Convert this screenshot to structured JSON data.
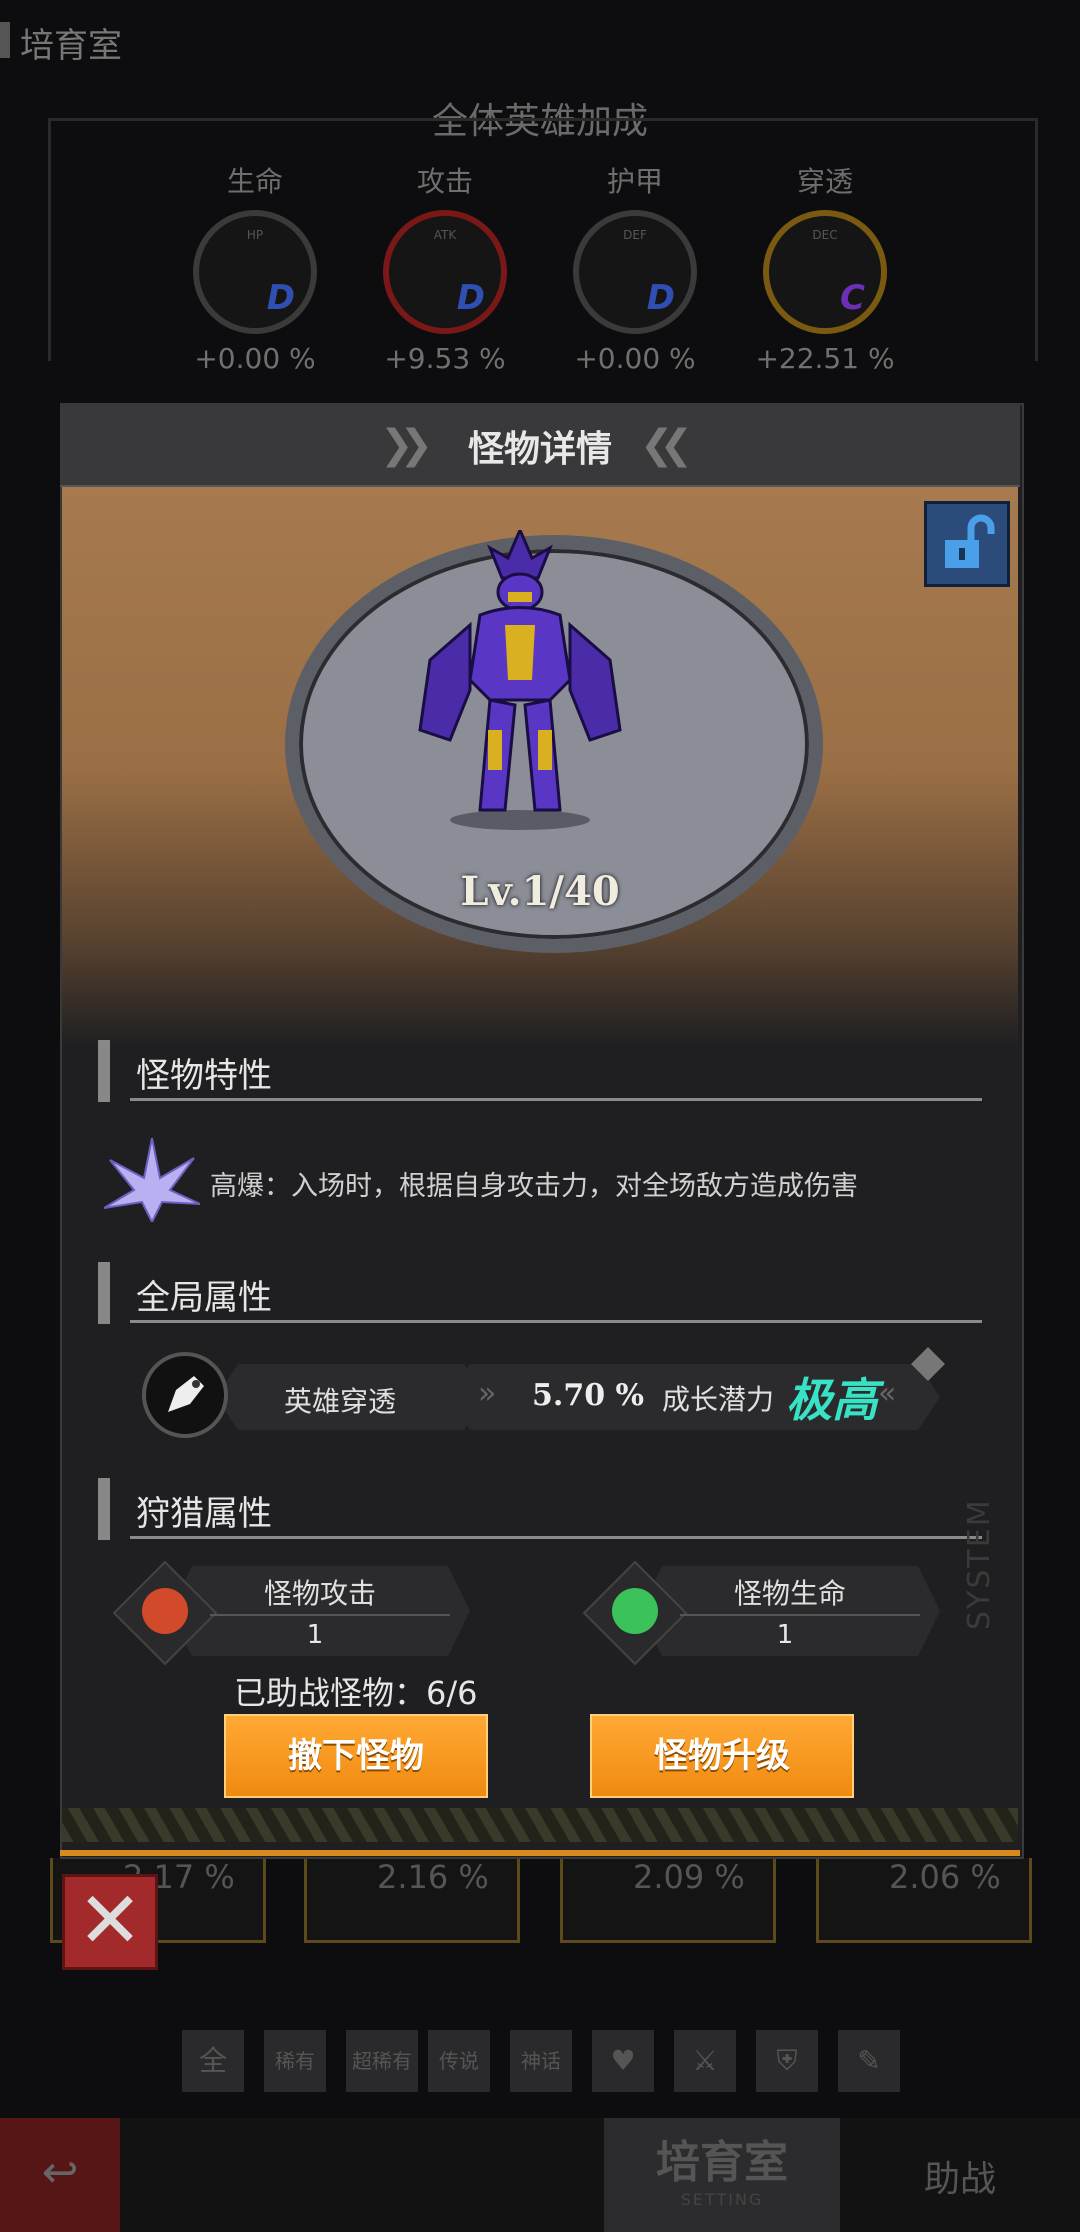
{
  "page": {
    "title": "培育室"
  },
  "bonus": {
    "title": "全体英雄加成",
    "stats": [
      {
        "label": "生命",
        "abbr": "HP",
        "grade": "D",
        "value": "+0.00 %",
        "color": "#2a2a2a",
        "grade_color": "#2f4fb5"
      },
      {
        "label": "攻击",
        "abbr": "ATK",
        "grade": "D",
        "value": "+9.53 %",
        "color": "#8a1a1a",
        "grade_color": "#2f4fb5"
      },
      {
        "label": "护甲",
        "abbr": "DEF",
        "grade": "D",
        "value": "+0.00 %",
        "color": "#2a2a2a",
        "grade_color": "#2f4fb5"
      },
      {
        "label": "穿透",
        "abbr": "DEC",
        "grade": "C",
        "value": "+22.51 %",
        "color": "#8a6a10",
        "grade_color": "#6a2fb5"
      }
    ]
  },
  "modal": {
    "title": "怪物详情",
    "level": "Lv.1/40",
    "sections": {
      "trait": "怪物特性",
      "global": "全局属性",
      "hunt": "狩猎属性"
    },
    "trait_text": "高爆：入场时，根据自身攻击力，对全场敌方造成伤害",
    "global": {
      "label": "英雄穿透",
      "value": "5.70 %",
      "growth_label": "成长潜力",
      "growth_value": "极高"
    },
    "hunt": {
      "attack_label": "怪物攻击",
      "attack_value": "1",
      "hp_label": "怪物生命",
      "hp_value": "1"
    },
    "assist_text": "已助战怪物：6/6",
    "remove_btn": "撤下怪物",
    "upgrade_btn": "怪物升级",
    "watermark": "SYSTEM"
  },
  "cards": [
    "2.17 %",
    "2.16 %",
    "2.09 %",
    "2.06 %"
  ],
  "filters": [
    "全",
    "稀有",
    "超稀有",
    "传说",
    "神话"
  ],
  "close_label": "✕",
  "nav": {
    "back_icon": "↩",
    "active": "培育室",
    "active_sub": "SETTING",
    "assist": "助战"
  },
  "colors": {
    "accent": "#f08a10",
    "potential": "#38e2c4"
  }
}
